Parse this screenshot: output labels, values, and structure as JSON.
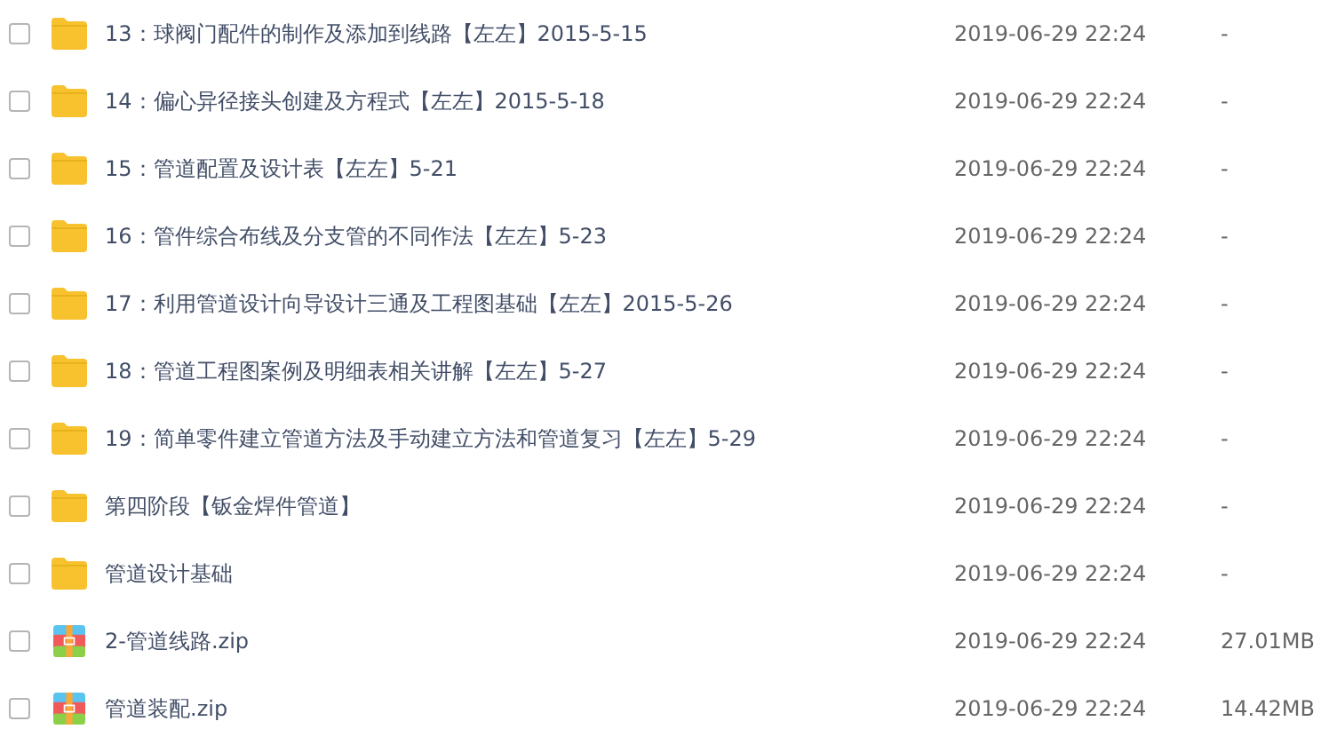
{
  "files": [
    {
      "kind": "folder",
      "checked": false,
      "name": "13：球阀门配件的制作及添加到线路【左左】2015-5-15",
      "date": "2019-06-29 22:24",
      "size": "-"
    },
    {
      "kind": "folder",
      "checked": false,
      "name": "14：偏心异径接头创建及方程式【左左】2015-5-18",
      "date": "2019-06-29 22:24",
      "size": "-"
    },
    {
      "kind": "folder",
      "checked": false,
      "name": "15：管道配置及设计表【左左】5-21",
      "date": "2019-06-29 22:24",
      "size": "-"
    },
    {
      "kind": "folder",
      "checked": false,
      "name": "16：管件综合布线及分支管的不同作法【左左】5-23",
      "date": "2019-06-29 22:24",
      "size": "-"
    },
    {
      "kind": "folder",
      "checked": false,
      "name": "17：利用管道设计向导设计三通及工程图基础【左左】2015-5-26",
      "date": "2019-06-29 22:24",
      "size": "-"
    },
    {
      "kind": "folder",
      "checked": false,
      "name": "18：管道工程图案例及明细表相关讲解【左左】5-27",
      "date": "2019-06-29 22:24",
      "size": "-"
    },
    {
      "kind": "folder",
      "checked": false,
      "name": "19：简单零件建立管道方法及手动建立方法和管道复习【左左】5-29",
      "date": "2019-06-29 22:24",
      "size": "-"
    },
    {
      "kind": "folder",
      "checked": false,
      "name": "第四阶段【钣金焊件管道】",
      "date": "2019-06-29 22:24",
      "size": "-"
    },
    {
      "kind": "folder",
      "checked": false,
      "name": "管道设计基础",
      "date": "2019-06-29 22:24",
      "size": "-"
    },
    {
      "kind": "zip",
      "checked": false,
      "name": "2-管道线路.zip",
      "date": "2019-06-29 22:24",
      "size": "27.01MB"
    },
    {
      "kind": "zip",
      "checked": false,
      "name": "管道装配.zip",
      "date": "2019-06-29 22:24",
      "size": "14.42MB"
    }
  ]
}
